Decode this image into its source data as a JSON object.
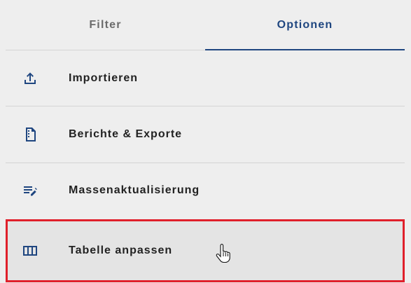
{
  "tabs": [
    {
      "label": "Filter",
      "active": false
    },
    {
      "label": "Optionen",
      "active": true
    }
  ],
  "menu": {
    "items": [
      {
        "label": "Importieren",
        "icon": "upload-icon"
      },
      {
        "label": "Berichte & Exporte",
        "icon": "report-document-icon"
      },
      {
        "label": "Massenaktualisierung",
        "icon": "edit-list-icon"
      },
      {
        "label": "Tabelle anpassen",
        "icon": "table-columns-icon",
        "highlighted": true
      }
    ]
  },
  "colors": {
    "accent": "#1f4680",
    "highlight_border": "#e0202b",
    "background": "#eeeeee"
  }
}
